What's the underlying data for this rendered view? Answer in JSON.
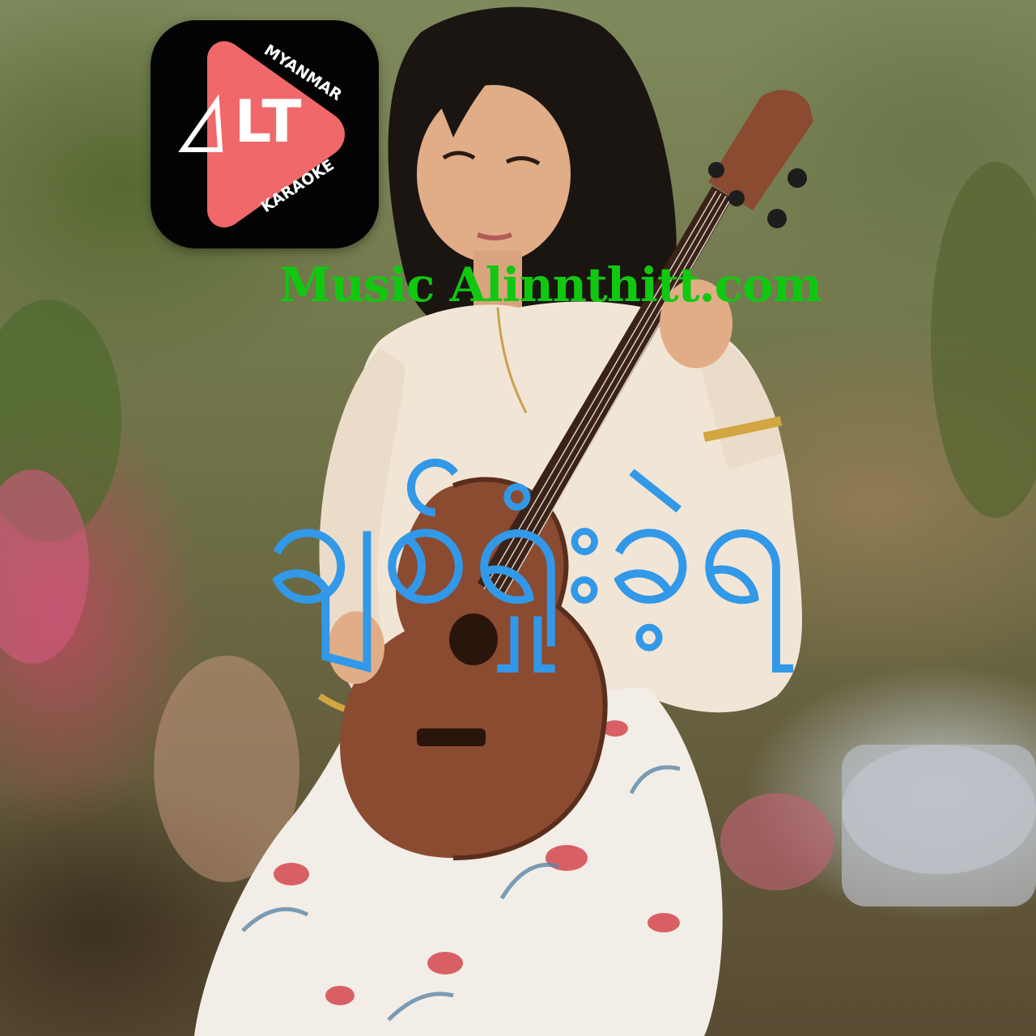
{
  "logo": {
    "icon": "play-triangle-icon",
    "wordmark": "LT",
    "top_text": "MYANMAR",
    "bottom_text": "KARAOKE",
    "colors": {
      "tile": "#030303",
      "triangle": "#f0686a",
      "text": "#ffffff"
    }
  },
  "caption": {
    "text": "Music Alinnthitt.com",
    "color": "#11c811"
  },
  "title": {
    "text": "ချစ်ရှုံးခဲ့ရ",
    "color": "#3298e8"
  },
  "photo": {
    "subject": "woman-playing-ukulele",
    "colors": {
      "sweater": "#f1e5d6",
      "hair": "#1b1512",
      "ukulele": "#8a4b31",
      "skirt": "#f2ede6",
      "flowers": "#d4464e"
    }
  }
}
